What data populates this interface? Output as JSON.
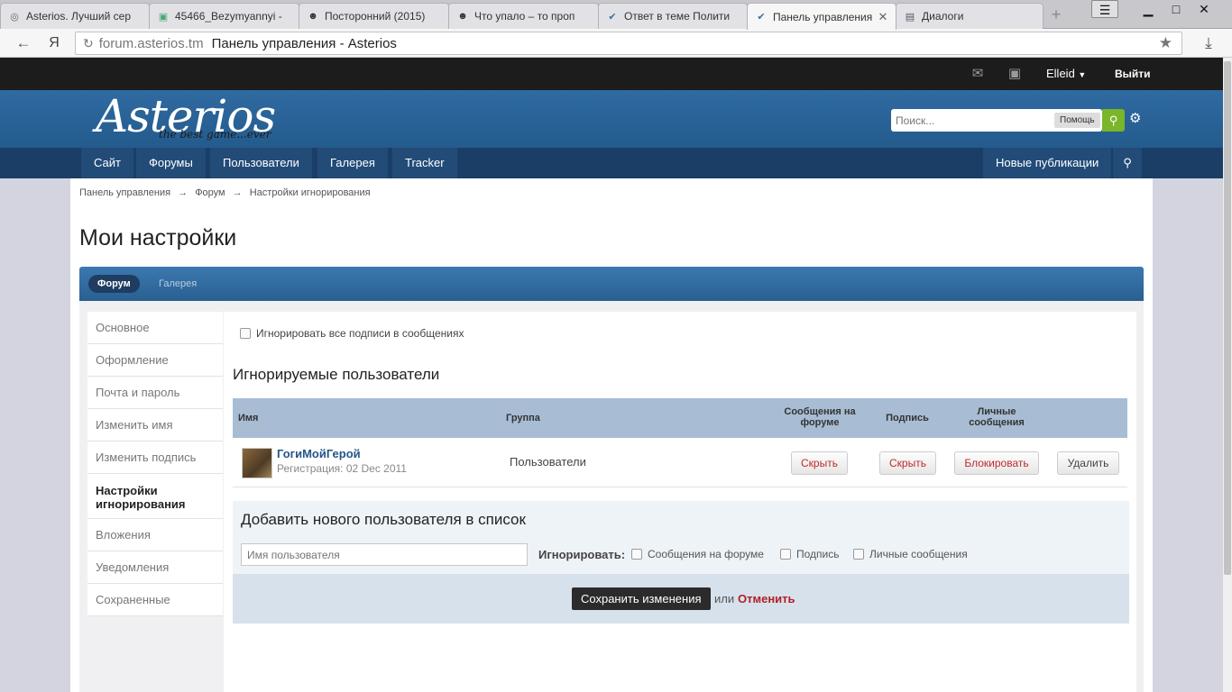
{
  "browser": {
    "tabs": [
      {
        "label": "Asterios. Лучший сер",
        "icon": "asterios-icon"
      },
      {
        "label": "45466_Bezymyannyi -",
        "icon": "image-icon"
      },
      {
        "label": "Посторонний (2015)",
        "icon": "face-icon"
      },
      {
        "label": "Что упало – то проп",
        "icon": "face-icon"
      },
      {
        "label": "Ответ в теме Полити",
        "icon": "checkmark-icon"
      },
      {
        "label": "Панель управления",
        "icon": "checkmark-icon"
      },
      {
        "label": "Диалоги",
        "icon": "chat-icon"
      }
    ],
    "active_tab": 5,
    "url_host": "forum.asterios.tm",
    "url_title": "Панель управления - Asterios"
  },
  "topbar": {
    "user": "Elleid",
    "logout": "Выйти"
  },
  "header": {
    "logo": "Asterios",
    "logo_sub": "the best game...ever",
    "search_placeholder": "Поиск...",
    "search_help": "Помощь"
  },
  "nav": {
    "items": [
      "Сайт",
      "Форумы",
      "Пользователи",
      "Галерея",
      "Tracker"
    ],
    "new_posts": "Новые публикации"
  },
  "breadcrumb": [
    "Панель управления",
    "→",
    "Форум",
    "→",
    "Настройки игнорирования"
  ],
  "page_title": "Мои настройки",
  "tabs": {
    "forum": "Форум",
    "gallery": "Галерея"
  },
  "sidebar": [
    "Основное",
    "Оформление",
    "Почта и пароль",
    "Изменить имя",
    "Изменить подпись",
    "Настройки игнорирования",
    "Вложения",
    "Уведомления",
    "Сохраненные"
  ],
  "sidebar_active": 5,
  "ignore_signatures": "Игнорировать все подписи в сообщениях",
  "ignored_title": "Игнорируемые пользователи",
  "table": {
    "headers": {
      "name": "Имя",
      "group": "Группа",
      "forum_posts": "Сообщения на форуме",
      "signature": "Подпись",
      "private_messages": "Личные сообщения"
    },
    "rows": [
      {
        "name": "ГогиМойГерой",
        "registered": "Регистрация: 02 Dec 2011",
        "group": "Пользователи",
        "forum_action": "Скрыть",
        "signature_action": "Скрыть",
        "pm_action": "Блокировать",
        "delete": "Удалить"
      }
    ]
  },
  "add_user": {
    "title": "Добавить нового пользователя в список",
    "placeholder": "Имя пользователя",
    "ignore_label": "Игнорировать:",
    "opt_posts": "Сообщения на форуме",
    "opt_signature": "Подпись",
    "opt_pm": "Личные сообщения",
    "save": "Сохранить изменения",
    "or": "или",
    "cancel": "Отменить"
  },
  "colors": {
    "header_blue": "#2f6aa1",
    "nav_dark": "#1b3e66",
    "accent_green": "#7ab52a",
    "danger_red": "#c0292c"
  }
}
